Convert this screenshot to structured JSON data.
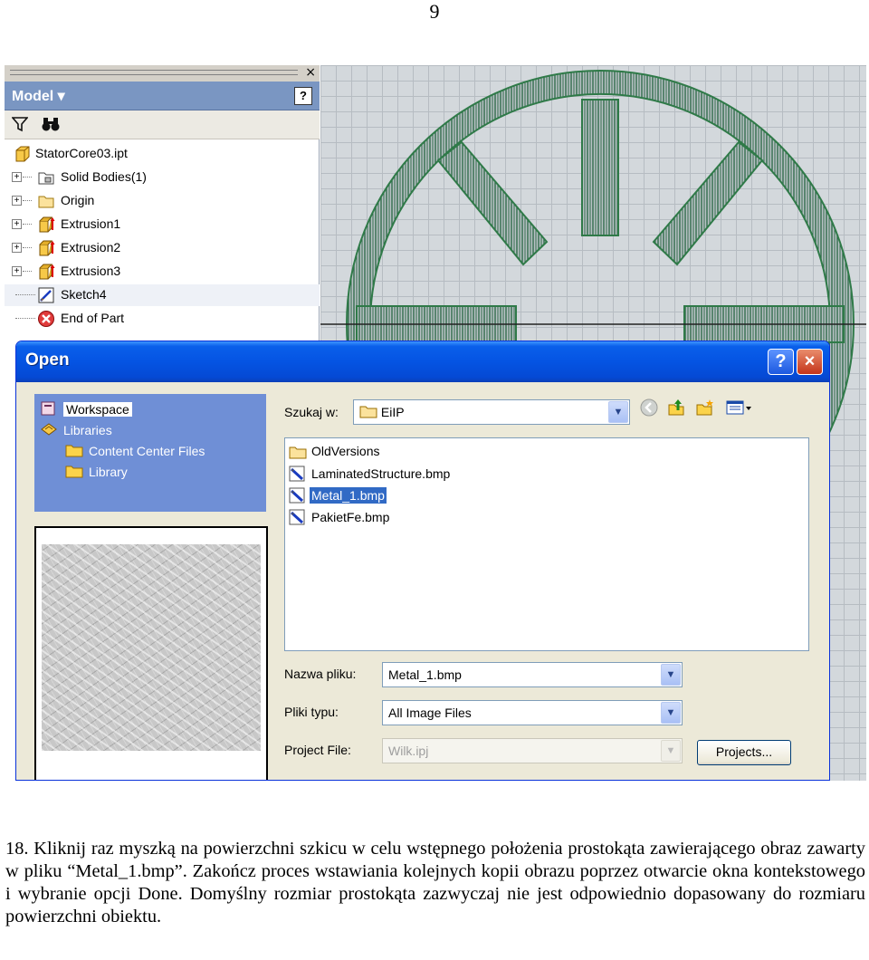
{
  "page_number": "9",
  "browser": {
    "title": "Model ▾",
    "help_label": "?",
    "close_label": "×",
    "toolbar": {
      "filter_icon": "funnel-icon",
      "find_icon": "binoculars-icon"
    },
    "tree": [
      {
        "label": "StatorCore03.ipt",
        "icon": "part-icon"
      },
      {
        "label": "Solid Bodies(1)",
        "icon": "solid-bodies-icon"
      },
      {
        "label": "Origin",
        "icon": "folder-icon"
      },
      {
        "label": "Extrusion1",
        "icon": "extrusion-icon"
      },
      {
        "label": "Extrusion2",
        "icon": "extrusion-icon"
      },
      {
        "label": "Extrusion3",
        "icon": "extrusion-icon"
      },
      {
        "label": "Sketch4",
        "icon": "sketch-icon"
      },
      {
        "label": "End of Part",
        "icon": "end-of-part-icon"
      }
    ]
  },
  "dialog": {
    "title": "Open",
    "help_button": "?",
    "close_button": "×",
    "locations": [
      {
        "label": "Workspace",
        "icon": "workspace-icon"
      },
      {
        "label": "Libraries",
        "icon": "libraries-icon"
      },
      {
        "label": "Content Center Files",
        "icon": "folder-icon"
      },
      {
        "label": "Library",
        "icon": "folder-icon"
      }
    ],
    "look_in_label": "Szukaj w:",
    "look_in_value": "EiIP",
    "files": [
      {
        "name": "OldVersions",
        "icon": "folder-icon"
      },
      {
        "name": "LaminatedStructure.bmp",
        "icon": "bitmap-file-icon"
      },
      {
        "name": "Metal_1.bmp",
        "icon": "bitmap-file-icon"
      },
      {
        "name": "PakietFe.bmp",
        "icon": "bitmap-file-icon"
      }
    ],
    "selected_file": "Metal_1.bmp",
    "file_name_label": "Nazwa pliku:",
    "file_name_value": "Metal_1.bmp",
    "file_type_label": "Pliki typu:",
    "file_type_value": "All Image Files",
    "project_file_label": "Project File:",
    "project_file_value": "Wilk.ipj",
    "projects_button": "Projects...",
    "colors": {
      "title_bar": "#0554e3",
      "selection": "#316ac5",
      "locations_pane": "#6f8fd6"
    }
  },
  "instruction_text": "18. Kliknij raz myszką na powierzchni szkicu w celu wstępnego położenia prostokąta zawierającego obraz zawarty w pliku “Metal_1.bmp”. Zakończ proces wstawiania kolejnych kopii obrazu poprzez otwarcie okna kontekstowego i wybranie opcji Done. Domyślny rozmiar prostokąta zazwyczaj nie jest odpowiednio dopasowany do rozmiaru powierzchni obiektu."
}
